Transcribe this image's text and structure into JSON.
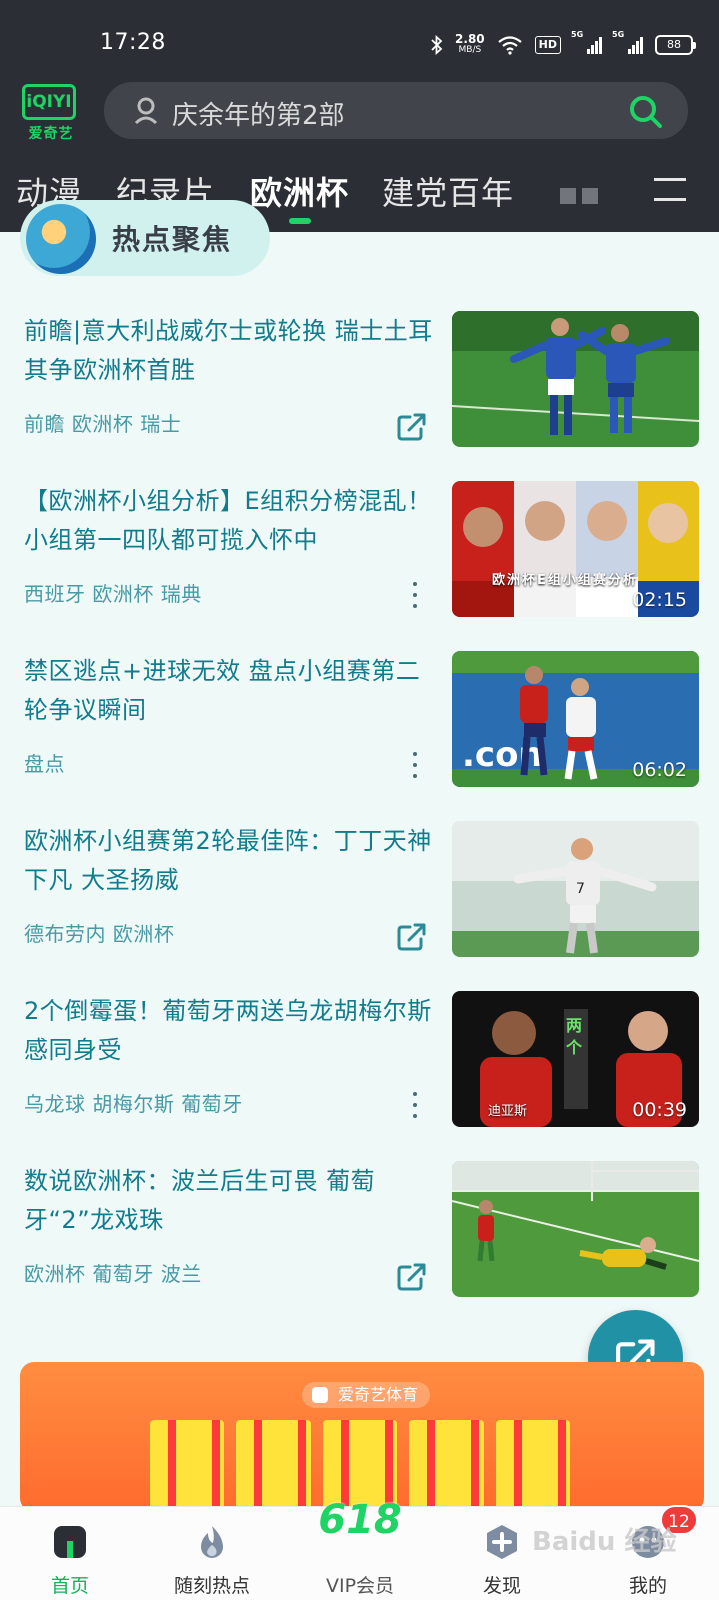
{
  "status_bar": {
    "time": "17:28",
    "net_speed_value": "2.80",
    "net_speed_unit": "MB/S",
    "hd_badge": "HD",
    "signal1": "5G",
    "signal2": "5G",
    "battery": "88"
  },
  "header": {
    "logo_mark": "iQIYI",
    "logo_text": "爱奇艺",
    "search_placeholder": "庆余年的第2部"
  },
  "tabs": {
    "items": [
      "动漫",
      "纪录片",
      "欧洲杯",
      "建党百年"
    ],
    "active_index": 2
  },
  "section": {
    "title": "热点聚焦"
  },
  "feed": {
    "items": [
      {
        "title": "前瞻|意大利战威尔士或轮换 瑞士土耳其争欧洲杯首胜",
        "tags": "前瞻 欧洲杯 瑞士",
        "action": "share-icon",
        "duration": ""
      },
      {
        "title": "【欧洲杯小组分析】E组积分榜混乱！小组第一四队都可揽入怀中",
        "tags": "西班牙 欧洲杯 瑞典",
        "action": "more-icon",
        "duration": "02:15",
        "caption": "欧洲杯E组小组赛分析"
      },
      {
        "title": "禁区逃点+进球无效 盘点小组赛第二轮争议瞬间",
        "tags": "盘点",
        "action": "more-icon",
        "duration": "06:02"
      },
      {
        "title": "欧洲杯小组赛第2轮最佳阵：丁丁天神下凡 大圣扬威",
        "tags": "德布劳内 欧洲杯",
        "action": "share-icon",
        "duration": ""
      },
      {
        "title": "2个倒霉蛋！葡萄牙两送乌龙胡梅尔斯感同身受",
        "tags": "乌龙球 胡梅尔斯 葡萄牙",
        "action": "more-icon",
        "duration": "00:39",
        "caption": "迪亚斯"
      },
      {
        "title": "数说欧洲杯：波兰后生可畏 葡萄牙“2”龙戏珠",
        "tags": "欧洲杯 葡萄牙 波兰",
        "action": "share-icon",
        "duration": ""
      }
    ]
  },
  "banner": {
    "brand": "爱奇艺体育"
  },
  "bottom_nav": {
    "items": [
      {
        "label": "首页",
        "active": true
      },
      {
        "label": "随刻热点",
        "active": false
      },
      {
        "label": "VIP会员",
        "active": false
      },
      {
        "label": "发现",
        "active": false
      },
      {
        "label": "我的",
        "active": false
      }
    ],
    "vip_promo": "618",
    "badge_count": "12",
    "watermark": "Baidu 经验"
  },
  "colors": {
    "header_bg": "#2b2e35",
    "accent_green": "#1fd365",
    "feed_text": "#137c8c",
    "page_bg": "#eef9f8",
    "fab": "#2191a5"
  }
}
